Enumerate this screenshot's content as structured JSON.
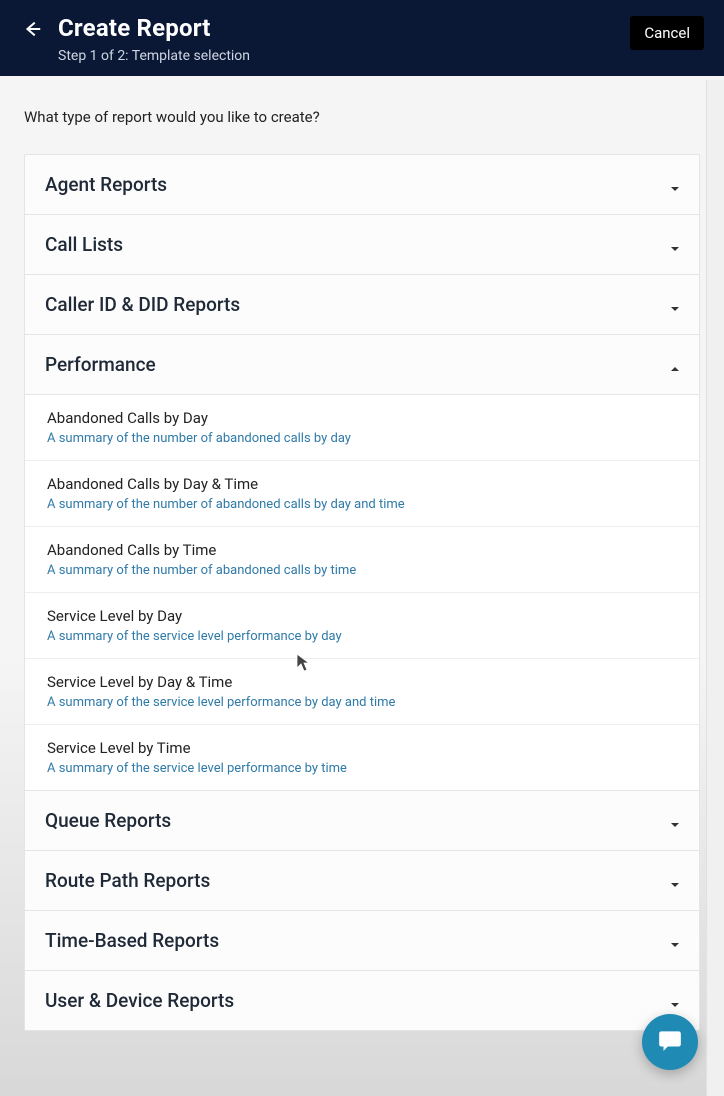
{
  "header": {
    "title": "Create Report",
    "subtitle": "Step 1 of 2: Template selection",
    "cancel_label": "Cancel"
  },
  "prompt": "What type of report would you like to create?",
  "sections": [
    {
      "title": "Agent Reports",
      "expanded": false
    },
    {
      "title": "Call Lists",
      "expanded": false
    },
    {
      "title": "Caller ID & DID Reports",
      "expanded": false
    },
    {
      "title": "Performance",
      "expanded": true,
      "items": [
        {
          "title": "Abandoned Calls by Day",
          "desc": "A summary of the number of abandoned calls by day"
        },
        {
          "title": "Abandoned Calls by Day & Time",
          "desc": "A summary of the number of abandoned calls by day and time"
        },
        {
          "title": "Abandoned Calls by Time",
          "desc": "A summary of the number of abandoned calls by time"
        },
        {
          "title": "Service Level by Day",
          "desc": "A summary of the service level performance by day"
        },
        {
          "title": "Service Level by Day & Time",
          "desc": "A summary of the service level performance by day and time"
        },
        {
          "title": "Service Level by Time",
          "desc": "A summary of the service level performance by time"
        }
      ]
    },
    {
      "title": "Queue Reports",
      "expanded": false
    },
    {
      "title": "Route Path Reports",
      "expanded": false
    },
    {
      "title": "Time-Based Reports",
      "expanded": false
    },
    {
      "title": "User & Device Reports",
      "expanded": false
    }
  ]
}
